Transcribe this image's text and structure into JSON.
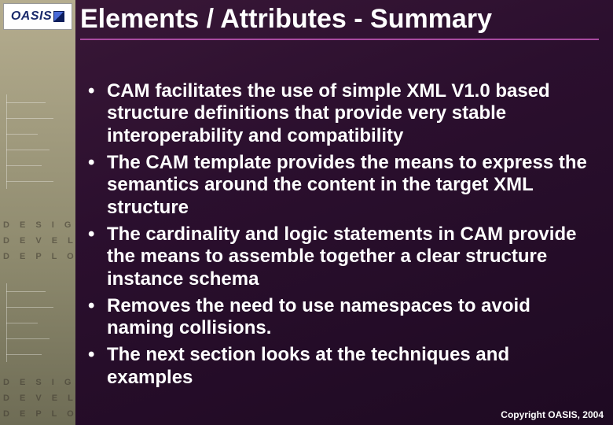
{
  "logo": {
    "text": "OASIS"
  },
  "title": "Elements / Attributes - Summary",
  "bullets": [
    "CAM facilitates the use of simple XML V1.0 based structure definitions that provide very stable interoperability and compatibility",
    "The CAM template provides the means to express the semantics around the content in the target XML structure",
    "The cardinality and logic statements in CAM provide the means to assemble together a clear structure instance schema",
    "Removes the need to use namespaces to avoid naming collisions.",
    "The next section looks at the techniques and examples"
  ],
  "side_labels": {
    "l1": "D E S I G N",
    "l2": "D E V E L O P",
    "l3": "D E P L O Y",
    "l4": "D E S I G N",
    "l5": "D E V E L O P",
    "l6": "D E P L O Y"
  },
  "copyright": "Copyright OASIS, 2004"
}
